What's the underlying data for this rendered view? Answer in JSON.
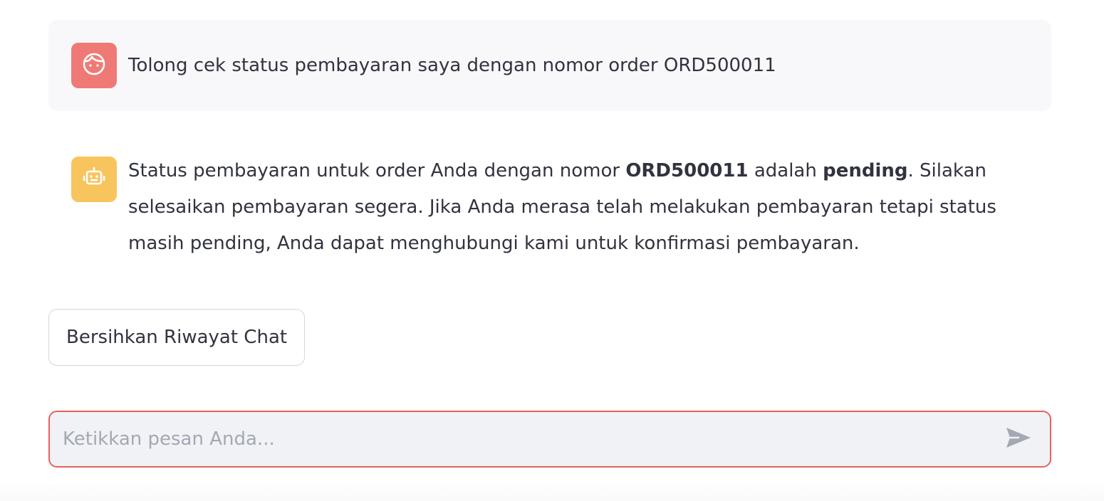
{
  "messages": [
    {
      "role": "user",
      "avatar_icon": "user-face-icon",
      "avatar_color": "#ef7a75",
      "text": "Tolong cek status pembayaran saya dengan nomor order ORD500011"
    },
    {
      "role": "assistant",
      "avatar_icon": "robot-icon",
      "avatar_color": "#f8c45e",
      "text_parts": [
        "Status pembayaran untuk order Anda dengan nomor ",
        "ORD500011",
        " adalah ",
        "pending",
        ". Silakan selesaikan pembayaran segera. Jika Anda merasa telah melakukan pembayaran tetapi status masih pending, Anda dapat menghubungi kami untuk konfirmasi pembayaran."
      ]
    }
  ],
  "clear_button": {
    "label": "Bersihkan Riwayat Chat"
  },
  "chat_input": {
    "value": "",
    "placeholder": "Ketikkan pesan Anda...",
    "border_color": "#e8615d",
    "send_icon": "send-icon"
  }
}
